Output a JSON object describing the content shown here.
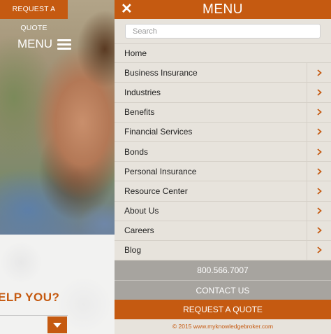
{
  "background_page": {
    "request_quote_label": "REQUEST A QUOTE",
    "menu_label": "MENU",
    "help_text": "ELP YOU?"
  },
  "menu": {
    "title": "MENU",
    "close_icon": "close-icon",
    "search": {
      "placeholder": "Search",
      "value": ""
    },
    "items": [
      {
        "label": "Home",
        "has_submenu": false
      },
      {
        "label": "Business Insurance",
        "has_submenu": true
      },
      {
        "label": "Industries",
        "has_submenu": true
      },
      {
        "label": "Benefits",
        "has_submenu": true
      },
      {
        "label": "Financial Services",
        "has_submenu": true
      },
      {
        "label": "Bonds",
        "has_submenu": true
      },
      {
        "label": "Personal Insurance",
        "has_submenu": true
      },
      {
        "label": "Resource Center",
        "has_submenu": true
      },
      {
        "label": "About Us",
        "has_submenu": true
      },
      {
        "label": "Careers",
        "has_submenu": true
      },
      {
        "label": "Blog",
        "has_submenu": true
      }
    ],
    "phone": "800.566.7007",
    "contact_label": "CONTACT US",
    "request_quote_label": "REQUEST A QUOTE",
    "copyright": "© 2015 www.myknowledgebroker.com"
  },
  "colors": {
    "accent": "#c55a11",
    "menu_bg": "#e7e3dc",
    "footer_gray": "#a7a49f"
  }
}
